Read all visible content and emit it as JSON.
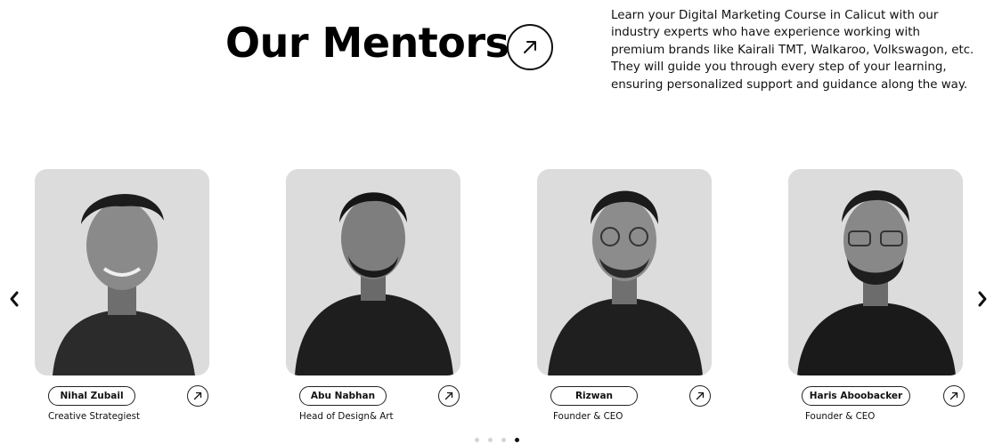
{
  "header": {
    "title": "Our Mentors",
    "intro": "Learn your Digital Marketing Course in Calicut with our industry experts who have experience working with premium brands like Kairali TMT, Walkaroo, Volkswagon, etc. They will guide you through every step of your learning, ensuring personalized support and guidance along the way."
  },
  "carousel": {
    "prev_icon": "chevron-left-icon",
    "next_icon": "chevron-right-icon",
    "active_slide": 4,
    "slide_count": 4,
    "mentors": [
      {
        "name": "Nihal Zubail",
        "role": "Creative Strategiest"
      },
      {
        "name": "Abu Nabhan",
        "role": "Head of Design& Art"
      },
      {
        "name": "Rizwan",
        "role": "Founder & CEO"
      },
      {
        "name": "Haris Aboobacker",
        "role": "Founder & CEO"
      }
    ]
  },
  "colors": {
    "text": "#111111",
    "photo_bg": "#dcdcdc",
    "dot_inactive": "#d4d4d4",
    "dot_active": "#111111"
  }
}
